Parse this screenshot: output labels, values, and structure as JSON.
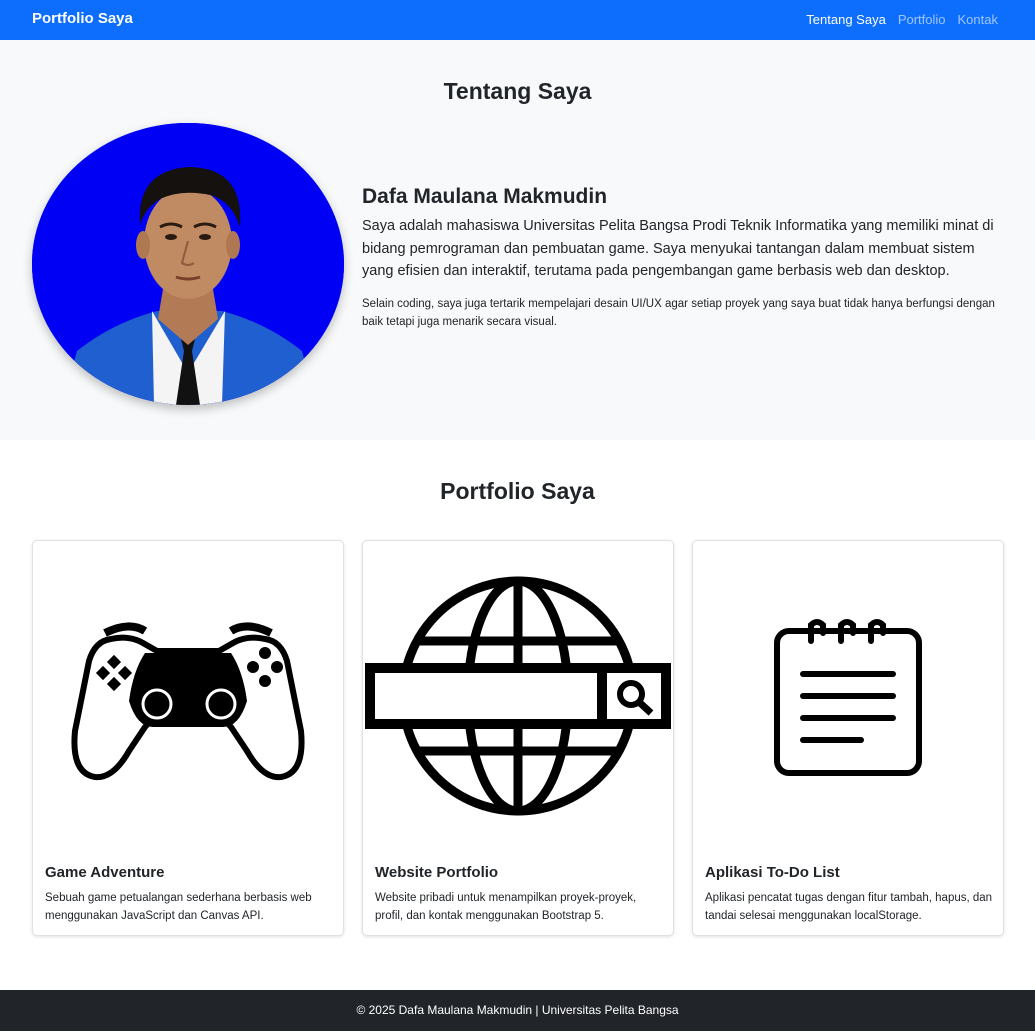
{
  "navbar": {
    "brand": "Portfolio Saya",
    "links": [
      {
        "label": "Tentang Saya"
      },
      {
        "label": "Portfolio"
      },
      {
        "label": "Kontak"
      }
    ]
  },
  "about": {
    "title": "Tentang Saya",
    "name": "Dafa Maulana Makmudin",
    "lead": "Saya adalah mahasiswa Universitas Pelita Bangsa Prodi Teknik Informatika yang memiliki minat di bidang pemrograman dan pembuatan game. Saya menyukai tantangan dalam membuat sistem yang efisien dan interaktif, terutama pada pengembangan game berbasis web dan desktop.",
    "detail": "Selain coding, saya juga tertarik mempelajari desain UI/UX agar setiap proyek yang saya buat tidak hanya berfungsi dengan baik tetapi juga menarik secara visual."
  },
  "portfolio": {
    "title": "Portfolio Saya",
    "cards": [
      {
        "title": "Game Adventure",
        "text": "Sebuah game petualangan sederhana berbasis web menggunakan JavaScript dan Canvas API.",
        "icon": "gamepad-icon"
      },
      {
        "title": "Website Portfolio",
        "text": "Website pribadi untuk menampilkan proyek-proyek, profil, dan kontak menggunakan Bootstrap 5.",
        "icon": "globe-search-icon"
      },
      {
        "title": "Aplikasi To-Do List",
        "text": "Aplikasi pencatat tugas dengan fitur tambah, hapus, dan tandai selesai menggunakan localStorage.",
        "icon": "notepad-icon"
      }
    ]
  },
  "footer": {
    "text": "© 2025 Dafa Maulana Makmudin | Universitas Pelita Bangsa"
  },
  "colors": {
    "primary": "#0d6efd",
    "light": "#f8f9fa",
    "dark": "#212529",
    "photo_bg": "#0000f5"
  }
}
